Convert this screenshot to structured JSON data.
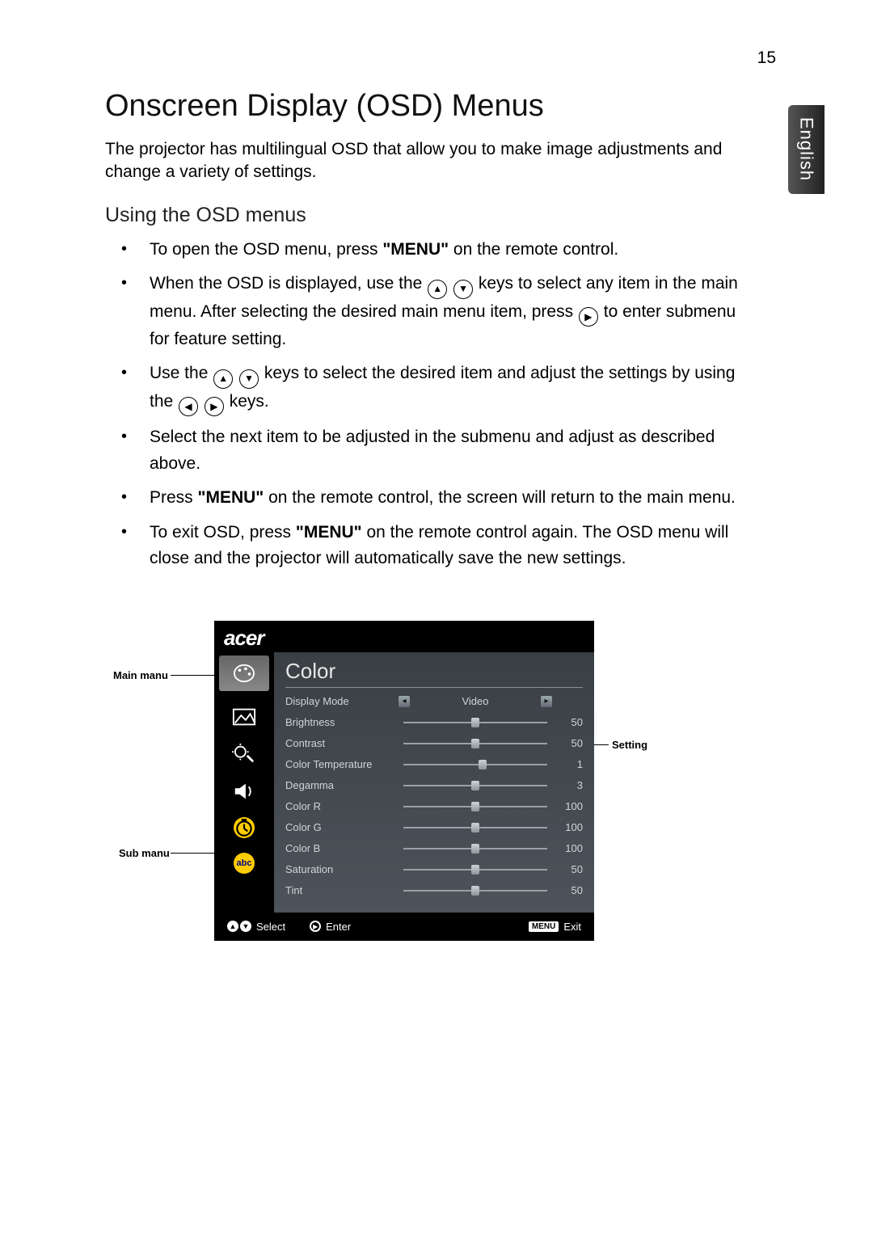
{
  "page_number": "15",
  "language_tab": "English",
  "title": "Onscreen Display (OSD) Menus",
  "intro": "The projector has multilingual OSD that allow you to make image adjustments and change a variety of settings.",
  "subtitle": "Using the OSD menus",
  "bullets": {
    "b0": {
      "pre": "To open the OSD menu, press ",
      "q1": "\"MENU\"",
      "post": " on the remote control."
    },
    "b1": {
      "pre": "When the OSD is displayed, use the ",
      "mid": " keys to select any item in the main menu. After selecting the desired main menu item, press ",
      "post": " to enter submenu for feature setting."
    },
    "b2": {
      "pre": "Use the ",
      "mid": " keys to select the desired item and adjust the settings by using the ",
      "post": " keys."
    },
    "b3": "Select the next item to be adjusted in the submenu and adjust as described above.",
    "b4": {
      "pre": "Press ",
      "q1": "\"MENU\"",
      "post": " on the remote control, the screen will return to the main menu."
    },
    "b5": {
      "pre": "To exit OSD, press ",
      "q1": "\"MENU\"",
      "post": " on the remote control again. The OSD menu will close and the projector will automatically save the new settings."
    }
  },
  "osd": {
    "brand": "acer",
    "menu_title": "Color",
    "rows": [
      {
        "label": "Display Mode",
        "type": "option",
        "value": "Video",
        "pct": 50
      },
      {
        "label": "Brightness",
        "type": "slider",
        "value": "50",
        "pct": 50
      },
      {
        "label": "Contrast",
        "type": "slider",
        "value": "50",
        "pct": 50
      },
      {
        "label": "Color Temperature",
        "type": "slider",
        "value": "1",
        "pct": 55
      },
      {
        "label": "Degamma",
        "type": "slider",
        "value": "3",
        "pct": 50
      },
      {
        "label": "Color R",
        "type": "slider",
        "value": "100",
        "pct": 50
      },
      {
        "label": "Color G",
        "type": "slider",
        "value": "100",
        "pct": 50
      },
      {
        "label": "Color B",
        "type": "slider",
        "value": "100",
        "pct": 50
      },
      {
        "label": "Saturation",
        "type": "slider",
        "value": "50",
        "pct": 50
      },
      {
        "label": "Tint",
        "type": "slider",
        "value": "50",
        "pct": 50
      }
    ],
    "footer": {
      "select": "Select",
      "enter": "Enter",
      "menu_label": "MENU",
      "exit": "Exit"
    }
  },
  "callouts": {
    "main_menu": "Main manu",
    "sub_menu": "Sub manu",
    "setting": "Setting"
  }
}
